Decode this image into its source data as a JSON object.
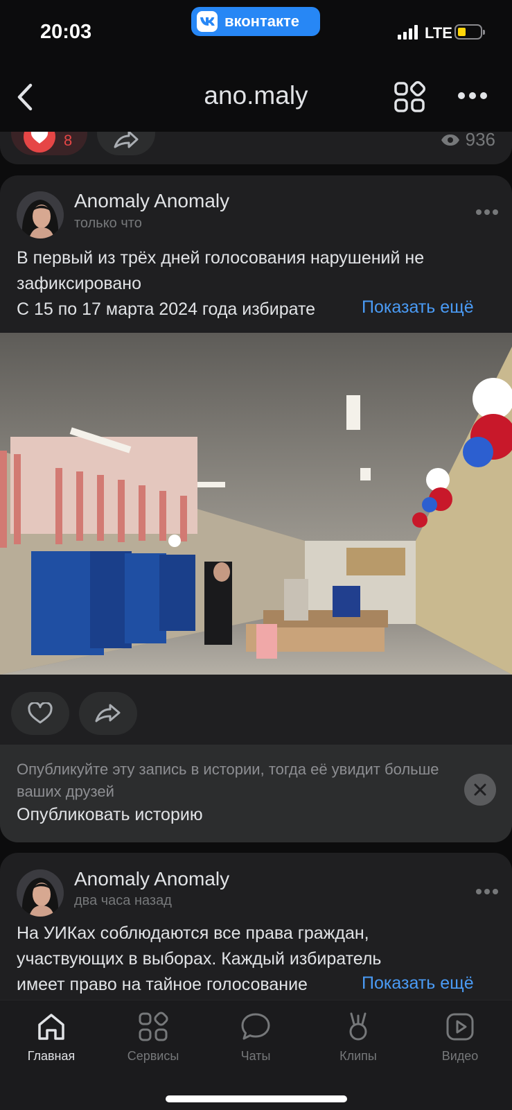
{
  "status": {
    "time": "20:03",
    "app_pill": "вконтакте",
    "network": "LTE",
    "battery_level": 0.35
  },
  "header": {
    "title": "ano.maly",
    "back_icon": "chevron-left-icon",
    "grid_icon": "services-grid-icon",
    "more_icon": "more-horizontal-icon"
  },
  "prev_post": {
    "likes": "8",
    "views": "936"
  },
  "post1": {
    "author": "Anomaly Anomaly",
    "time": "только что",
    "text_lines": [
      "В первый из трёх дней голосования нарушений не",
      "зафиксировано",
      "С 15 по 17 марта 2024 года избирате"
    ],
    "show_more": "Показать ещё",
    "story_prompt": "Опубликуйте эту запись в истории, тогда её увидит больше ваших друзей",
    "story_button": "Опубликовать историю"
  },
  "post2": {
    "author": "Anomaly Anomaly",
    "time": "два часа назад",
    "text_lines": [
      "На УИКах соблюдаются все права граждан,",
      "участвующих в выборах. Каждый избиратель",
      "имеет право на тайное голосование"
    ],
    "show_more": "Показать ещё"
  },
  "tabs": [
    {
      "label": "Главная",
      "icon": "home-icon",
      "active": true
    },
    {
      "label": "Сервисы",
      "icon": "services-icon",
      "active": false
    },
    {
      "label": "Чаты",
      "icon": "chat-icon",
      "active": false
    },
    {
      "label": "Клипы",
      "icon": "clips-icon",
      "active": false
    },
    {
      "label": "Видео",
      "icon": "video-icon",
      "active": false
    }
  ],
  "colors": {
    "accent": "#4a9bf5",
    "vk_blue": "#2787f5",
    "like_red": "#e64646",
    "card_bg": "#1f1f21"
  }
}
